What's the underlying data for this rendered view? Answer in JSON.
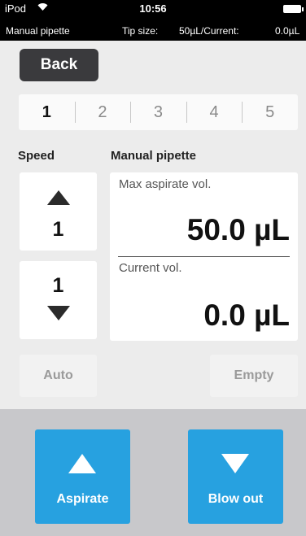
{
  "status_bar": {
    "carrier": "iPod",
    "wifi_icon": "wifi-icon",
    "time": "10:56",
    "battery_icon": "battery-icon",
    "mode": "Manual pipette",
    "tip_size_label": "Tip size:",
    "tip_size_value": "50µL/Current:",
    "current_value": "0.0µL"
  },
  "back_label": "Back",
  "tabs": [
    {
      "label": "1",
      "active": true
    },
    {
      "label": "2",
      "active": false
    },
    {
      "label": "3",
      "active": false
    },
    {
      "label": "4",
      "active": false
    },
    {
      "label": "5",
      "active": false
    }
  ],
  "speed": {
    "title": "Speed",
    "up_value": "1",
    "down_value": "1"
  },
  "pipette": {
    "title": "Manual pipette",
    "max_caption": "Max aspirate vol.",
    "max_value": "50.0 µL",
    "current_caption": "Current vol.",
    "current_value": "0.0 µL"
  },
  "auto_label": "Auto",
  "empty_label": "Empty",
  "aspirate_label": "Aspirate",
  "blowout_label": "Blow out",
  "colors": {
    "action_blue": "#27a1e0",
    "back_dark": "#3a3a3d"
  }
}
